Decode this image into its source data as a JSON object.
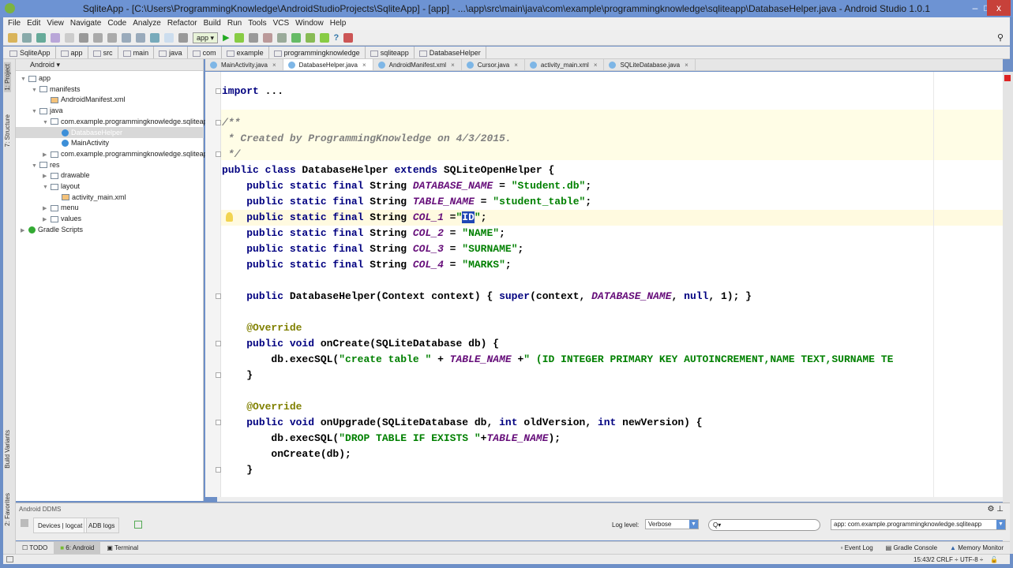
{
  "title": "SqliteApp - [C:\\Users\\ProgrammingKnowledge\\AndroidStudioProjects\\SqliteApp] - [app] - ...\\app\\src\\main\\java\\com\\example\\programmingknowledge\\sqliteapp\\DatabaseHelper.java - Android Studio 1.0.1",
  "window_controls": {
    "minimize": "–",
    "maximize": "□",
    "close": "x"
  },
  "menu": [
    "File",
    "Edit",
    "View",
    "Navigate",
    "Code",
    "Analyze",
    "Refactor",
    "Build",
    "Run",
    "Tools",
    "VCS",
    "Window",
    "Help"
  ],
  "run_config": "app",
  "breadcrumbs": [
    "SqliteApp",
    "app",
    "src",
    "main",
    "java",
    "com",
    "example",
    "programmingknowledge",
    "sqliteapp",
    "DatabaseHelper"
  ],
  "project_panel": {
    "view": "Android",
    "tree": [
      {
        "label": "app",
        "depth": 0,
        "arrow": "▼",
        "type": "folder"
      },
      {
        "label": "manifests",
        "depth": 1,
        "arrow": "▼",
        "type": "folder"
      },
      {
        "label": "AndroidManifest.xml",
        "depth": 2,
        "arrow": "",
        "type": "xml"
      },
      {
        "label": "java",
        "depth": 1,
        "arrow": "▼",
        "type": "folder"
      },
      {
        "label": "com.example.programmingknowledge.sqliteapp",
        "depth": 2,
        "arrow": "▼",
        "type": "folder"
      },
      {
        "label": "DatabaseHelper",
        "depth": 3,
        "arrow": "",
        "type": "class",
        "selected": true
      },
      {
        "label": "MainActivity",
        "depth": 3,
        "arrow": "",
        "type": "class"
      },
      {
        "label": "com.example.programmingknowledge.sqliteapp (androidTest)",
        "depth": 2,
        "arrow": "▶",
        "type": "folder"
      },
      {
        "label": "res",
        "depth": 1,
        "arrow": "▼",
        "type": "folder"
      },
      {
        "label": "drawable",
        "depth": 2,
        "arrow": "▶",
        "type": "folder"
      },
      {
        "label": "layout",
        "depth": 2,
        "arrow": "▼",
        "type": "folder"
      },
      {
        "label": "activity_main.xml",
        "depth": 3,
        "arrow": "",
        "type": "xml"
      },
      {
        "label": "menu",
        "depth": 2,
        "arrow": "▶",
        "type": "folder"
      },
      {
        "label": "values",
        "depth": 2,
        "arrow": "▶",
        "type": "folder"
      },
      {
        "label": "Gradle Scripts",
        "depth": 0,
        "arrow": "▶",
        "type": "gradle"
      }
    ]
  },
  "side_tabs": {
    "project": "1: Project",
    "structure": "7: Structure",
    "build_variants": "Build Variants",
    "favorites": "2: Favorites"
  },
  "editor_tabs": [
    {
      "label": "MainActivity.java",
      "active": false
    },
    {
      "label": "DatabaseHelper.java",
      "active": true
    },
    {
      "label": "AndroidManifest.xml",
      "active": false
    },
    {
      "label": "Cursor.java",
      "active": false
    },
    {
      "label": "activity_main.xml",
      "active": false
    },
    {
      "label": "SQLiteDatabase.java",
      "active": false
    }
  ],
  "code": [
    [
      [
        "kw",
        "import "
      ],
      [
        "",
        "..."
      ]
    ],
    [],
    [
      [
        "cm",
        "/**"
      ]
    ],
    [
      [
        "cm",
        " * Created by ProgrammingKnowledge on 4/3/2015."
      ]
    ],
    [
      [
        "cm",
        " */"
      ]
    ],
    [
      [
        "kw",
        "public class "
      ],
      [
        "",
        "DatabaseHelper "
      ],
      [
        "kw",
        "extends "
      ],
      [
        "",
        "SQLiteOpenHelper {"
      ]
    ],
    [
      [
        "",
        "    "
      ],
      [
        "kw",
        "public static final "
      ],
      [
        "",
        "String "
      ],
      [
        "cst",
        "DATABASE_NAME"
      ],
      [
        "",
        " = "
      ],
      [
        "str",
        "\"Student.db\""
      ],
      [
        "",
        ";"
      ]
    ],
    [
      [
        "",
        "    "
      ],
      [
        "kw",
        "public static final "
      ],
      [
        "",
        "String "
      ],
      [
        "cst",
        "TABLE_NAME"
      ],
      [
        "",
        " = "
      ],
      [
        "str",
        "\"student_table\""
      ],
      [
        "",
        ";"
      ]
    ],
    [
      [
        "",
        "    "
      ],
      [
        "kw",
        "public static final "
      ],
      [
        "",
        "String "
      ],
      [
        "cst",
        "COL_1"
      ],
      [
        "",
        " ="
      ],
      [
        "str",
        "\""
      ],
      [
        "sel",
        "ID"
      ],
      [
        "str",
        "\""
      ],
      [
        "",
        ";"
      ]
    ],
    [
      [
        "",
        "    "
      ],
      [
        "kw",
        "public static final "
      ],
      [
        "",
        "String "
      ],
      [
        "cst",
        "COL_2"
      ],
      [
        "",
        " = "
      ],
      [
        "str",
        "\"NAME\""
      ],
      [
        "",
        ";"
      ]
    ],
    [
      [
        "",
        "    "
      ],
      [
        "kw",
        "public static final "
      ],
      [
        "",
        "String "
      ],
      [
        "cst",
        "COL_3"
      ],
      [
        "",
        " = "
      ],
      [
        "str",
        "\"SURNAME\""
      ],
      [
        "",
        ";"
      ]
    ],
    [
      [
        "",
        "    "
      ],
      [
        "kw",
        "public static final "
      ],
      [
        "",
        "String "
      ],
      [
        "cst",
        "COL_4"
      ],
      [
        "",
        " = "
      ],
      [
        "str",
        "\"MARKS\""
      ],
      [
        "",
        ";"
      ]
    ],
    [],
    [
      [
        "",
        "    "
      ],
      [
        "kw",
        "public "
      ],
      [
        "",
        "DatabaseHelper(Context context) { "
      ],
      [
        "kw",
        "super"
      ],
      [
        "",
        "(context, "
      ],
      [
        "cst",
        "DATABASE_NAME"
      ],
      [
        "",
        ", "
      ],
      [
        "kw",
        "null"
      ],
      [
        "",
        ", "
      ],
      [
        "",
        "1); }"
      ]
    ],
    [],
    [
      [
        "",
        "    "
      ],
      [
        "an",
        "@Override"
      ]
    ],
    [
      [
        "",
        "    "
      ],
      [
        "kw",
        "public void "
      ],
      [
        "",
        "onCreate(SQLiteDatabase db) {"
      ]
    ],
    [
      [
        "",
        "        db.execSQL("
      ],
      [
        "str",
        "\"create table \""
      ],
      [
        "",
        " + "
      ],
      [
        "cst",
        "TABLE_NAME"
      ],
      [
        "",
        " +"
      ],
      [
        "str",
        "\" (ID INTEGER PRIMARY KEY AUTOINCREMENT,NAME TEXT,SURNAME TE"
      ]
    ],
    [
      [
        "",
        "    }"
      ]
    ],
    [],
    [
      [
        "",
        "    "
      ],
      [
        "an",
        "@Override"
      ]
    ],
    [
      [
        "",
        "    "
      ],
      [
        "kw",
        "public void "
      ],
      [
        "",
        "onUpgrade(SQLiteDatabase db, "
      ],
      [
        "kw",
        "int "
      ],
      [
        "",
        "oldVersion, "
      ],
      [
        "kw",
        "int "
      ],
      [
        "",
        "newVersion) {"
      ]
    ],
    [
      [
        "",
        "        db.execSQL("
      ],
      [
        "str",
        "\"DROP TABLE IF EXISTS \""
      ],
      [
        "",
        "+"
      ],
      [
        "cst",
        "TABLE_NAME"
      ],
      [
        "",
        ");"
      ]
    ],
    [
      [
        "",
        "        onCreate(db);"
      ]
    ],
    [
      [
        "",
        "    }"
      ]
    ]
  ],
  "ddms": {
    "title": "Android DDMS",
    "tab_devices": "Devices | logcat",
    "tab_adb": "ADB logs",
    "log_level_label": "Log level:",
    "log_level": "Verbose",
    "search_placeholder": "Q▾",
    "app_filter": "app: com.example.programmingknowledge.sqliteapp"
  },
  "bottom_tabs": {
    "todo": "TODO",
    "android": "6: Android",
    "terminal": "Terminal",
    "event_log": "Event Log",
    "gradle_console": "Gradle Console",
    "memory_monitor": "Memory Monitor"
  },
  "status": {
    "position": "15:43/2",
    "line_sep": "CRLF ÷",
    "encoding": "UTF-8 ÷"
  }
}
